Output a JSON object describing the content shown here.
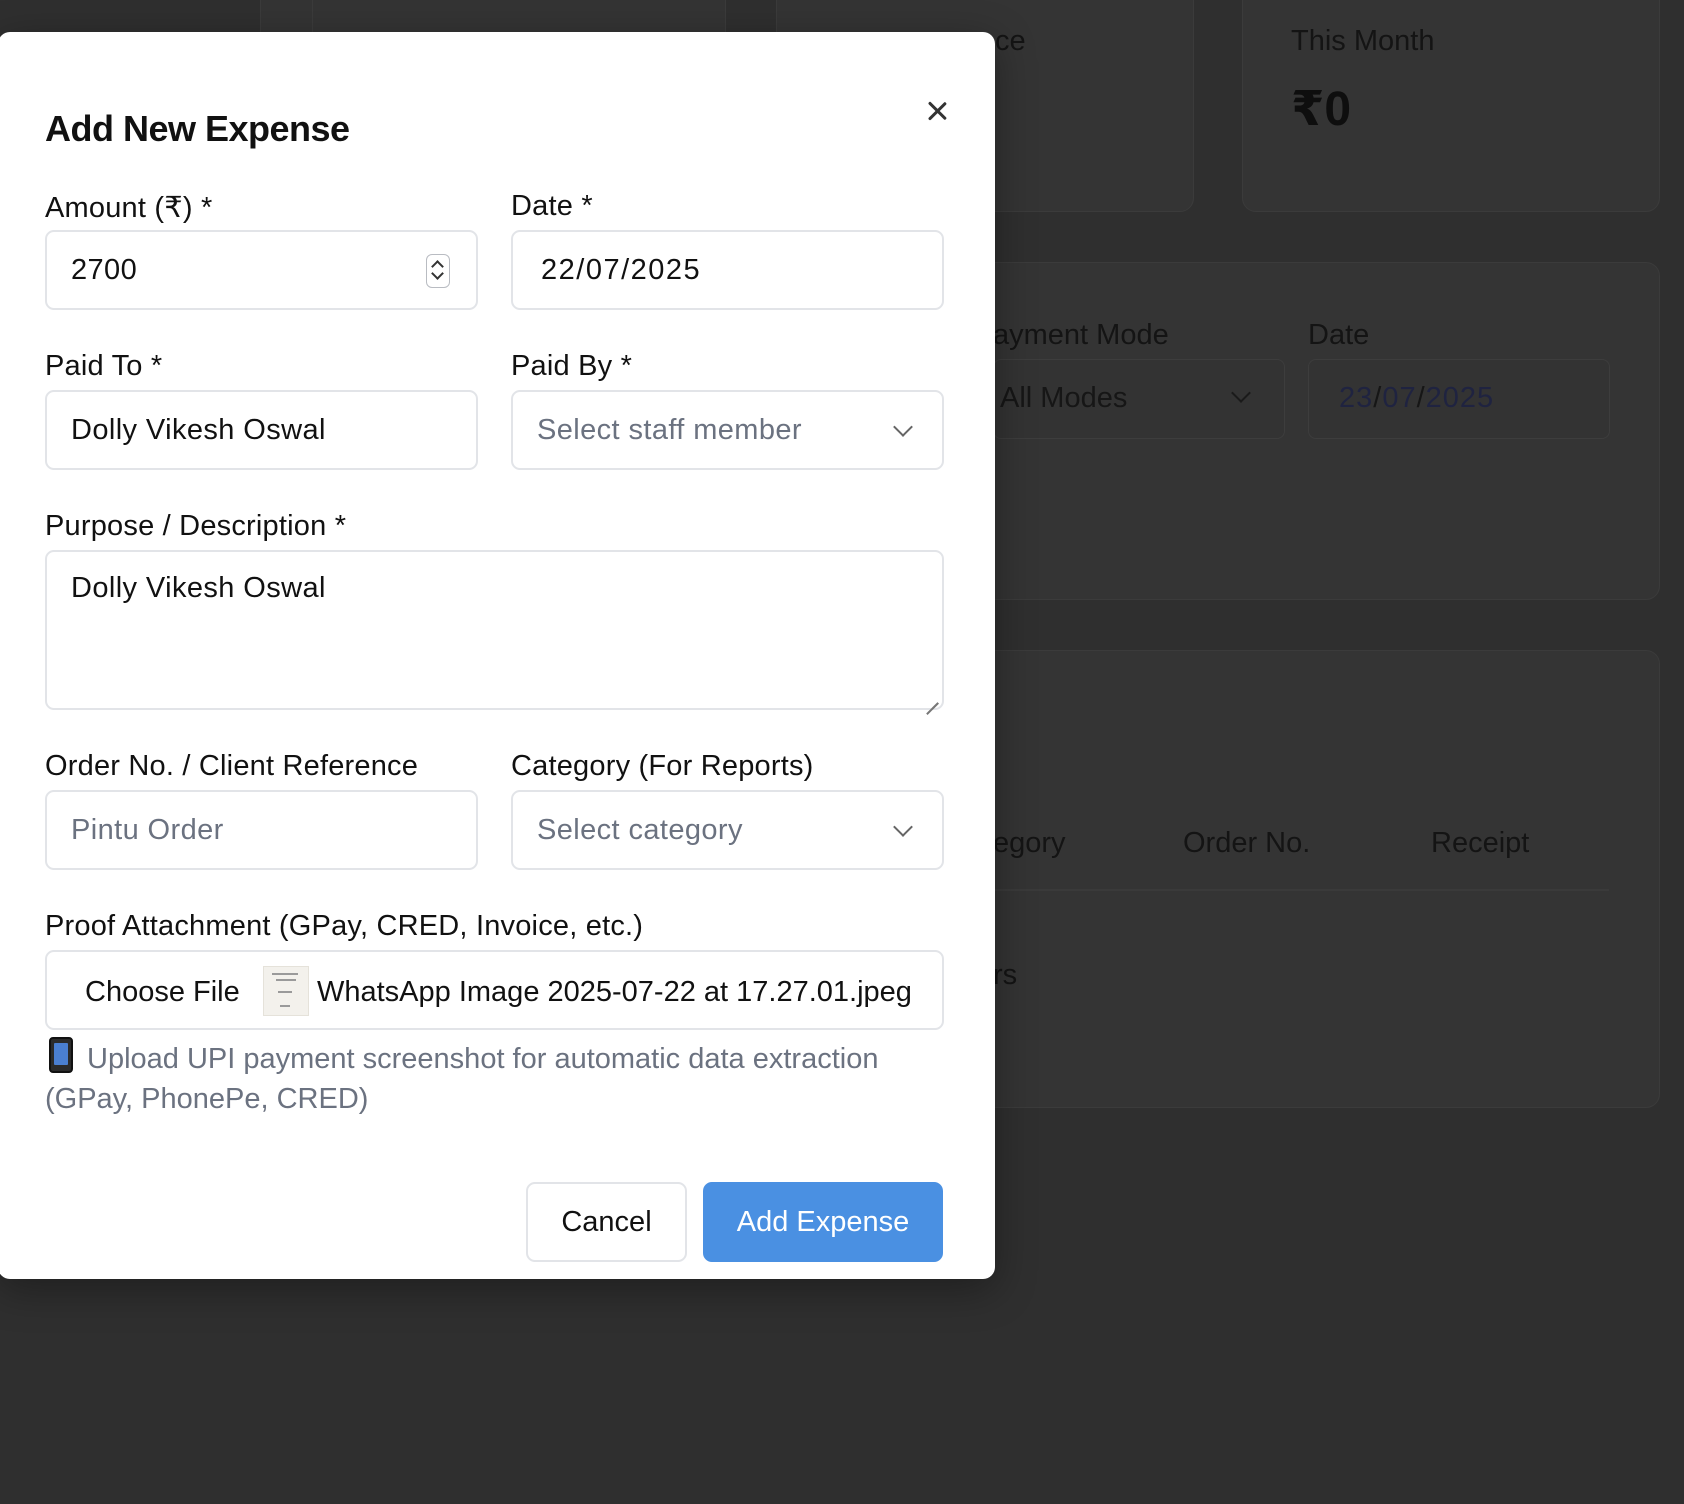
{
  "background": {
    "card_labels": [
      "ce",
      "This Month"
    ],
    "this_month_value": "₹0",
    "filters": {
      "payment_mode_label": "ayment Mode",
      "payment_mode_value": "All Modes",
      "date_label": "Date",
      "date_day": "23",
      "date_month": "07",
      "date_year": "2025"
    },
    "table_headers": [
      "egory",
      "Order No.",
      "Receipt"
    ],
    "empty_text": "rs"
  },
  "modal": {
    "title": "Add New Expense",
    "amount": {
      "label": "Amount (₹) *",
      "value": "2700"
    },
    "date": {
      "label": "Date *",
      "value": "22/07/2025"
    },
    "paid_to": {
      "label": "Paid To *",
      "value": "Dolly Vikesh Oswal"
    },
    "paid_by": {
      "label": "Paid By *",
      "placeholder": "Select staff member"
    },
    "purpose": {
      "label": "Purpose / Description *",
      "value": "Dolly Vikesh Oswal"
    },
    "order_no": {
      "label": "Order No. / Client Reference",
      "placeholder": "Pintu Order"
    },
    "category": {
      "label": "Category (For Reports)",
      "placeholder": "Select category"
    },
    "proof": {
      "label": "Proof Attachment (GPay, CRED, Invoice, etc.)",
      "choose_label": "Choose File",
      "file_name": "WhatsApp Image 2025-07-22 at 17.27.01.jpeg",
      "hint": "Upload UPI payment screenshot for automatic data extraction (GPay, PhonePe, CRED)"
    },
    "cancel_label": "Cancel",
    "submit_label": "Add Expense",
    "submit_color": "#4a90e2"
  }
}
